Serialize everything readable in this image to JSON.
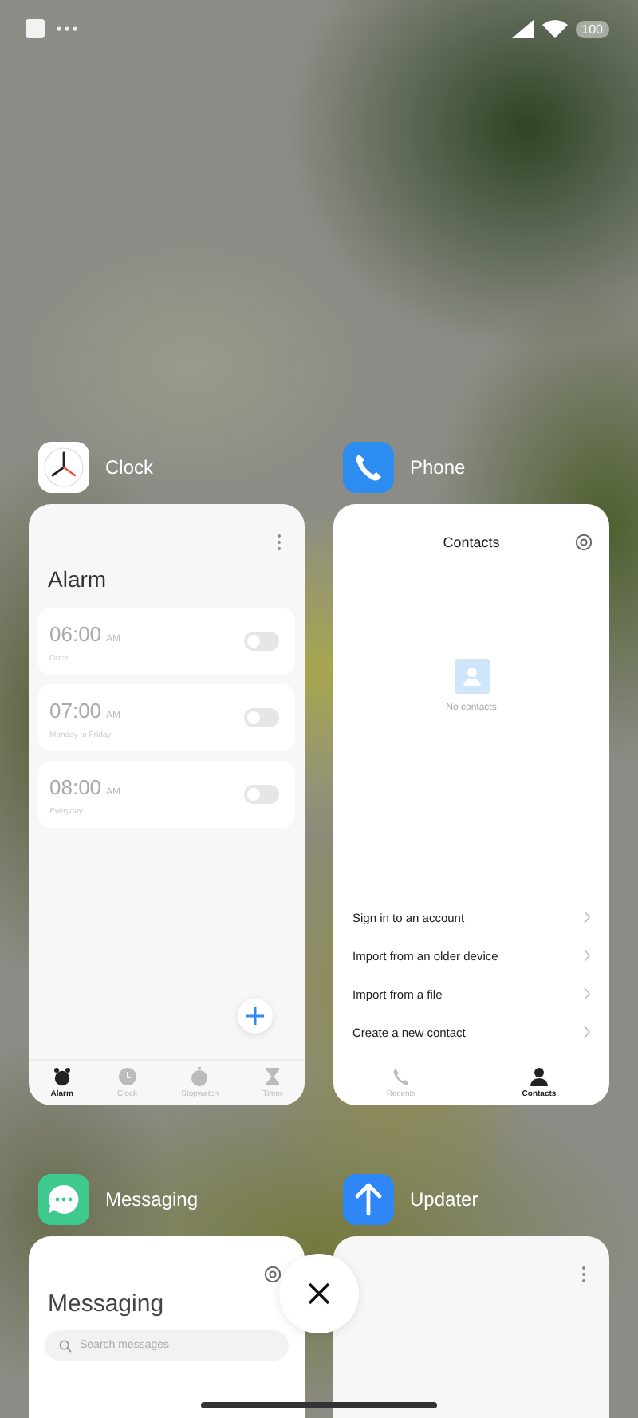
{
  "status_bar": {
    "battery": "100"
  },
  "apps": [
    {
      "kind": "clock",
      "name": "Clock",
      "screen": {
        "title": "Alarm",
        "alarms": [
          {
            "time": "06:00",
            "period": "AM",
            "label": "Once",
            "on": false
          },
          {
            "time": "07:00",
            "period": "AM",
            "label": "Monday to Friday",
            "on": false
          },
          {
            "time": "08:00",
            "period": "AM",
            "label": "Everyday",
            "on": false
          }
        ],
        "tabs": [
          {
            "label": "Alarm",
            "selected": true
          },
          {
            "label": "Clock",
            "selected": false
          },
          {
            "label": "Stopwatch",
            "selected": false
          },
          {
            "label": "Timer",
            "selected": false
          }
        ]
      }
    },
    {
      "kind": "contacts",
      "name": "Phone",
      "screen": {
        "title": "Contacts",
        "empty_text": "No contacts",
        "actions": [
          "Sign in to an account",
          "Import from an older device",
          "Import from a file",
          "Create a new contact"
        ],
        "tabs": [
          {
            "label": "Recents",
            "selected": false
          },
          {
            "label": "Contacts",
            "selected": true
          }
        ]
      }
    },
    {
      "kind": "messaging",
      "name": "Messaging",
      "screen": {
        "title": "Messaging",
        "search": {
          "placeholder": "Search messages"
        }
      }
    },
    {
      "kind": "updater",
      "name": "Updater"
    }
  ]
}
